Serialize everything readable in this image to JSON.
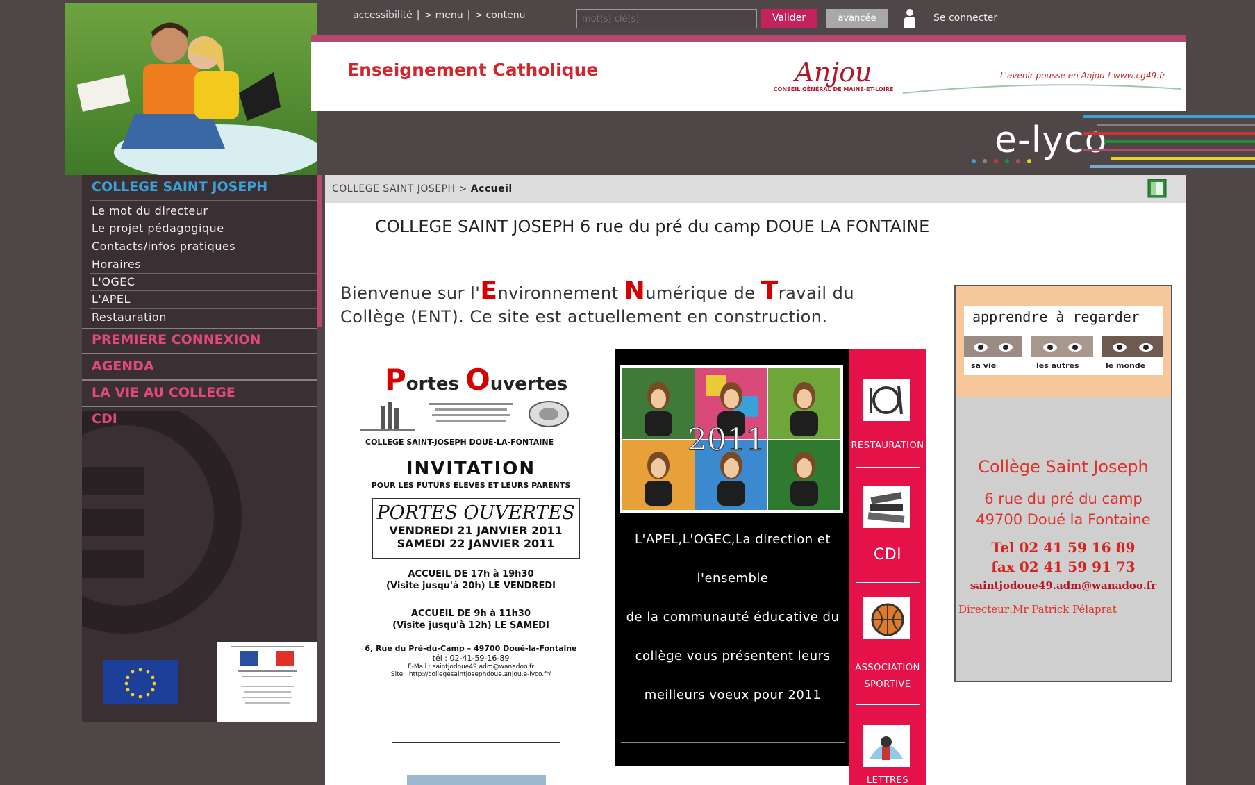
{
  "top": {
    "links": [
      "accessibilité",
      "> menu",
      "> contenu"
    ],
    "sep": "|",
    "search_placeholder": "mot(s) clé(s)",
    "valider_label": "Valider",
    "avancee_label": "avancée",
    "connect_label": "Se connecter"
  },
  "header": {
    "brand": "Enseignement Catholique",
    "anjou_logo_text": "Anjou",
    "anjou_caption": "CONSEIL GÉNÉRAL DE MAINE-ET-LOIRE",
    "slogan": "L'avenir pousse en Anjou !  www.cg49.fr",
    "elyco": "e-lyco"
  },
  "sidebar": {
    "title": "COLLEGE SAINT JOSEPH",
    "items": [
      "Le mot du directeur",
      "Le projet pédagogique",
      "Contacts/infos pratiques",
      "Horaires",
      "L'OGEC",
      "L'APEL",
      "Restauration"
    ],
    "sections": [
      "PREMIERE CONNEXION",
      "AGENDA",
      "LA VIE AU COLLEGE",
      "CDI"
    ]
  },
  "breadcrumb": {
    "parent": "COLLEGE SAINT JOSEPH",
    "sep": ">",
    "current": "Accueil"
  },
  "main": {
    "title": "COLLEGE SAINT JOSEPH 6 rue du pré du camp DOUE LA FONTAINE",
    "welcome": {
      "p1": "Bienvenue sur l'",
      "E": "E",
      "p2": "nvironnement ",
      "N": "N",
      "p3": "umérique de ",
      "T": "T",
      "p4": "ravail du Collège (ENT). Ce site est actuellement en construction."
    }
  },
  "flyer": {
    "P": "P",
    "ortes": "ortes ",
    "O": "O",
    "uvertes": "uvertes",
    "school": "COLLEGE SAINT-JOSEPH    DOUÉ-LA-FONTAINE",
    "invitation": "INVITATION",
    "invitation_sub": "POUR LES FUTURS ELEVES  ET LEURS PARENTS",
    "box_title": "PORTES OUVERTES",
    "date1": "VENDREDI 21 JANVIER 2011",
    "date2": "SAMEDI 22 JANVIER 2011",
    "acc1a": "ACCUEIL  DE 17h à 19h30",
    "acc1b": "(Visite jusqu'à 20h)  LE VENDREDI",
    "acc2a": "ACCUEIL  DE 9h à 11h30",
    "acc2b": "(Visite jusqu'à 12h) LE SAMEDI",
    "addr": "6, Rue du Pré-du-Camp – 49700 Doué-la-Fontaine",
    "tel": "tél : 02-41-59-16-89",
    "mail": "E-Mail : saintjodoue49.adm@wanadoo.fr",
    "site": "Site : http://collegesaintjosephdoue.anjou.e-lyco.fr/"
  },
  "voeux": {
    "year": "2011",
    "lines": [
      "L'APEL,L'OGEC,La direction et",
      "l'ensemble",
      "de la communauté éducative du",
      "collège vous présentent leurs",
      "meilleurs voeux pour 2011"
    ]
  },
  "quicklinks": [
    "RESTAURATION",
    "CDI",
    "ASSOCIATION",
    "SPORTIVE",
    "LETTRES"
  ],
  "contact_card": {
    "banner_title": "apprendre à regarder",
    "captions": [
      "sa vie",
      "les autres",
      "le monde"
    ],
    "name": "Collège Saint Joseph",
    "street": "6 rue du pré du camp",
    "city": "49700 Doué la Fontaine",
    "tel": "Tel 02 41 59 16 89",
    "fax": "fax 02 41 59 91 73",
    "email": "saintjodoue49.adm@wanadoo.fr",
    "director": "Directeur:Mr Patrick Pélaprat"
  },
  "colors": {
    "accent_pink": "#e0487e",
    "accent_red": "#e5124a",
    "sidebar_bg": "#3a2f33",
    "page_bg": "#4f4648",
    "title_blue": "#3aa1d8"
  }
}
